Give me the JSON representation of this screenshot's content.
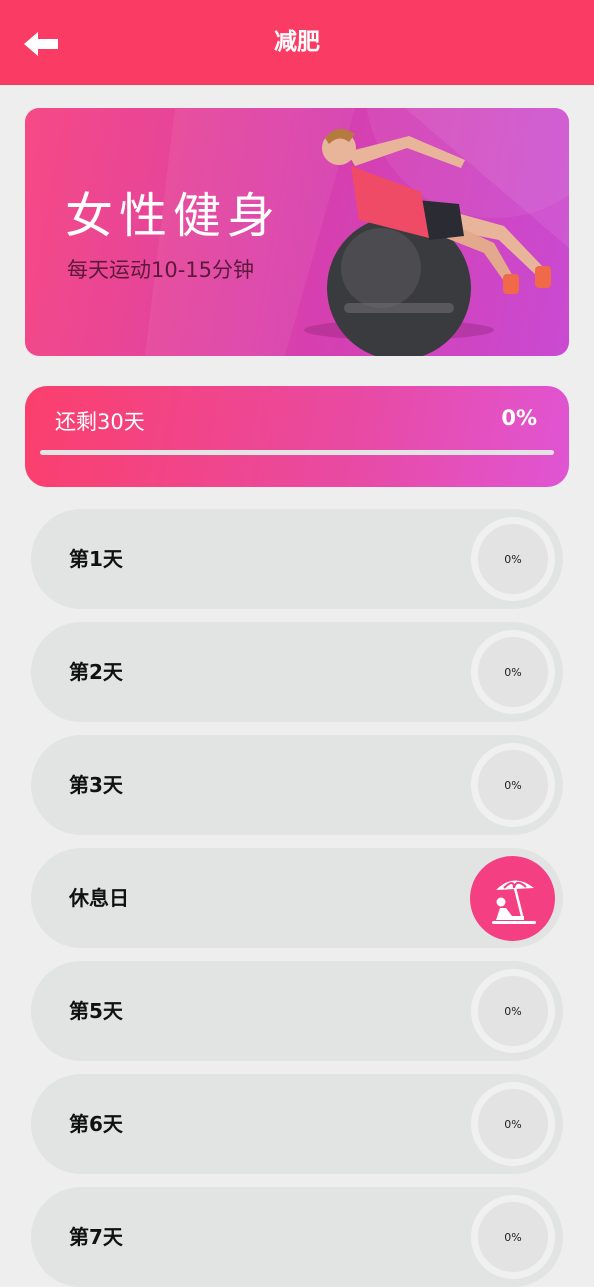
{
  "header": {
    "title": "减肥",
    "back_icon": "arrow-left-icon"
  },
  "banner": {
    "title": "女性健身",
    "subtitle": "每天运动10-15分钟"
  },
  "progress": {
    "remaining": "还剩30天",
    "percent_label": "0%",
    "percent_value": 0
  },
  "days": [
    {
      "label": "第1天",
      "percent": "0%"
    },
    {
      "label": "第2天",
      "percent": "0%"
    },
    {
      "label": "第3天",
      "percent": "0%"
    },
    {
      "label": "休息日",
      "icon": "beach-umbrella-rest-icon"
    },
    {
      "label": "第5天",
      "percent": "0%"
    },
    {
      "label": "第6天",
      "percent": "0%"
    },
    {
      "label": "第7天",
      "percent": "0%"
    }
  ],
  "colors": {
    "brand": "#fa3c64",
    "rest_icon_bg": "#f43f83"
  }
}
